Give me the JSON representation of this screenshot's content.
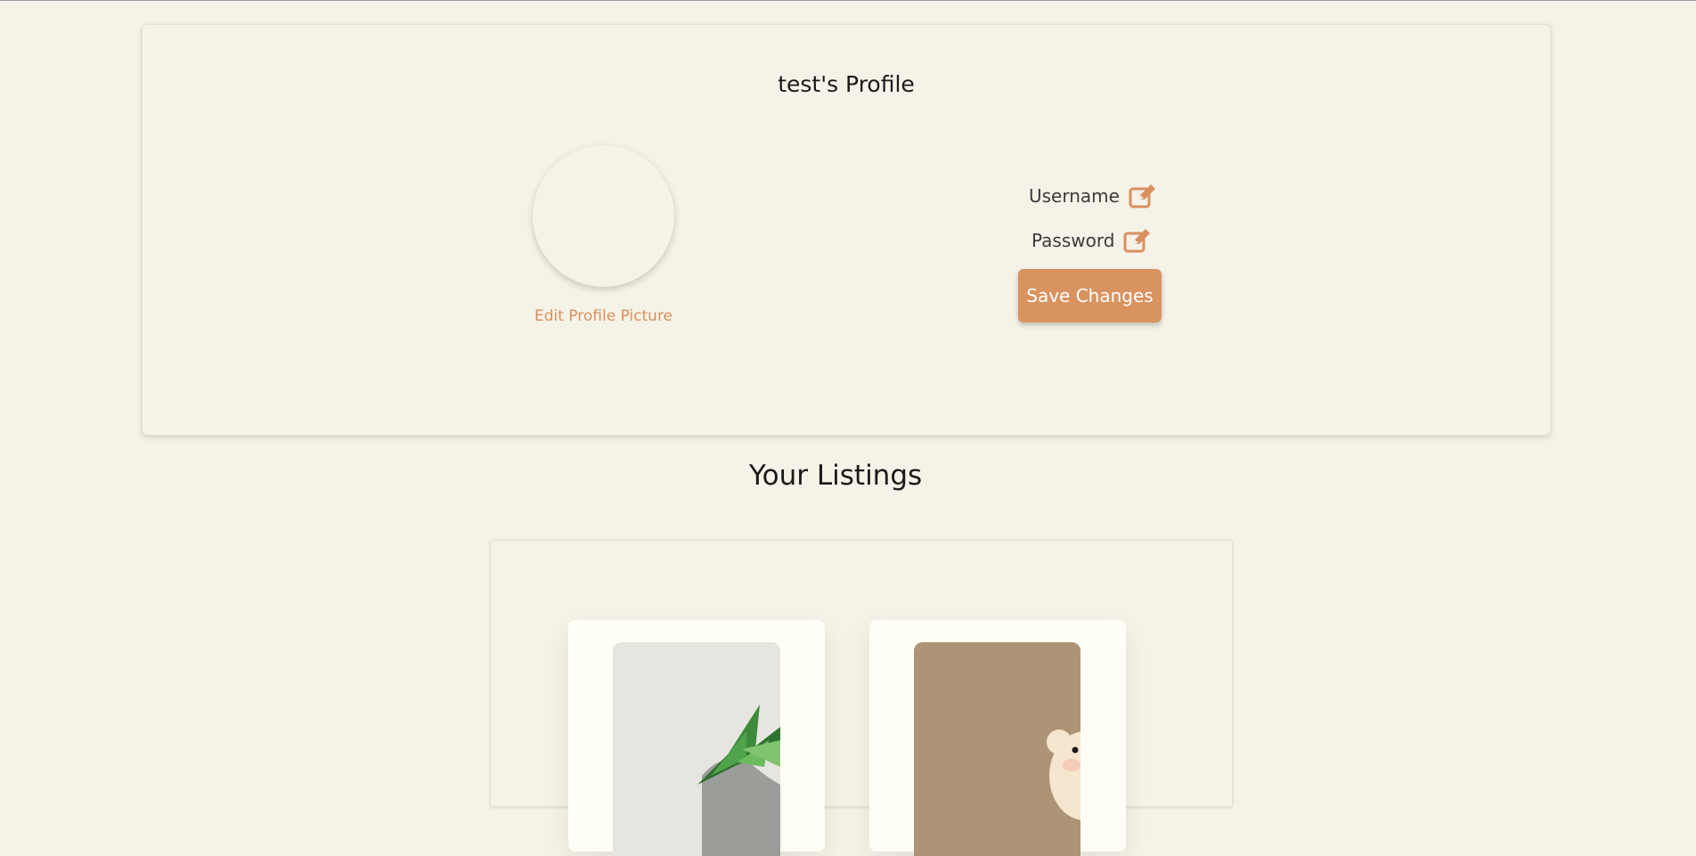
{
  "profile": {
    "title": "test's Profile",
    "edit_picture_label": "Edit Profile Picture",
    "fields": [
      {
        "label": "Username",
        "icon": "edit-icon"
      },
      {
        "label": "Password",
        "icon": "edit-icon"
      }
    ],
    "save_label": "Save Changes"
  },
  "listings": {
    "title": "Your Listings",
    "items": [
      {
        "image": "succulent-plant-image"
      },
      {
        "image": "bear-illustration-image"
      }
    ]
  },
  "colors": {
    "background": "#f5f2e7",
    "accent": "#d9935f",
    "card": "#fffef5"
  }
}
